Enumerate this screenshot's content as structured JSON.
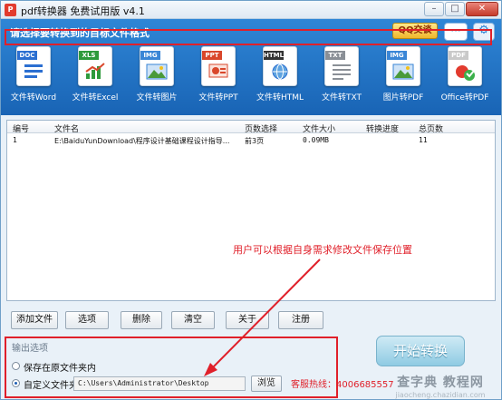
{
  "window": {
    "title": "pdf转换器 免费试用版 v4.1",
    "min_glyph": "–",
    "max_glyph": "□",
    "close_glyph": "✕"
  },
  "header": {
    "prompt": "请选择要转换到的目标文件格式",
    "qq_label": "QQ交谈",
    "chat_icon": "speech-bubble-icon",
    "settings_icon": "gear-icon"
  },
  "formats": [
    {
      "tag": "DOC",
      "label": "文件转Word",
      "color": "#2b6fd1",
      "glyph": "doc"
    },
    {
      "tag": "XLS",
      "label": "文件转Excel",
      "color": "#2e9a3b",
      "glyph": "chart"
    },
    {
      "tag": "IMG",
      "label": "文件转图片",
      "color": "#3a86d6",
      "glyph": "image"
    },
    {
      "tag": "PPT",
      "label": "文件转PPT",
      "color": "#d9472b",
      "glyph": "ppt"
    },
    {
      "tag": "HTML",
      "label": "文件转HTML",
      "color": "#333333",
      "glyph": "globe"
    },
    {
      "tag": "TXT",
      "label": "文件转TXT",
      "color": "#8a8f96",
      "glyph": "lines"
    },
    {
      "tag": "IMG",
      "label": "图片转PDF",
      "color": "#3a86d6",
      "glyph": "image"
    },
    {
      "tag": "PDF",
      "label": "Office转PDF",
      "color": "#c9c9c9",
      "glyph": "pdf"
    }
  ],
  "table": {
    "headers": [
      "编号",
      "文件名",
      "页数选择",
      "文件大小",
      "转换进度",
      "总页数"
    ],
    "rows": [
      {
        "id": "1",
        "filename": "E:\\BaiduYunDownload\\程序设计基础课程设计指导...",
        "pages": "前3页",
        "size": "0.09MB",
        "progress": "",
        "total": "11"
      }
    ]
  },
  "annotation": "用户可以根据自身需求修改文件保存位置",
  "buttons": {
    "add": "添加文件",
    "options": "选项",
    "delete": "删除",
    "clear": "清空",
    "about": "关于",
    "register": "注册"
  },
  "output": {
    "title": "输出选项",
    "opt_original": "保存在原文件夹内",
    "opt_custom": "自定义文件夹",
    "selected": "custom",
    "path": "C:\\Users\\Administrator\\Desktop",
    "browse": "浏览"
  },
  "start": "开始转换",
  "hotline": "客服热线：4006685557",
  "watermark": {
    "big": "查字典 教程网",
    "small": "jiaocheng.chazidian.com"
  },
  "colors": {
    "accent_red": "#e0202a",
    "header_blue": "#1f6ec3"
  }
}
